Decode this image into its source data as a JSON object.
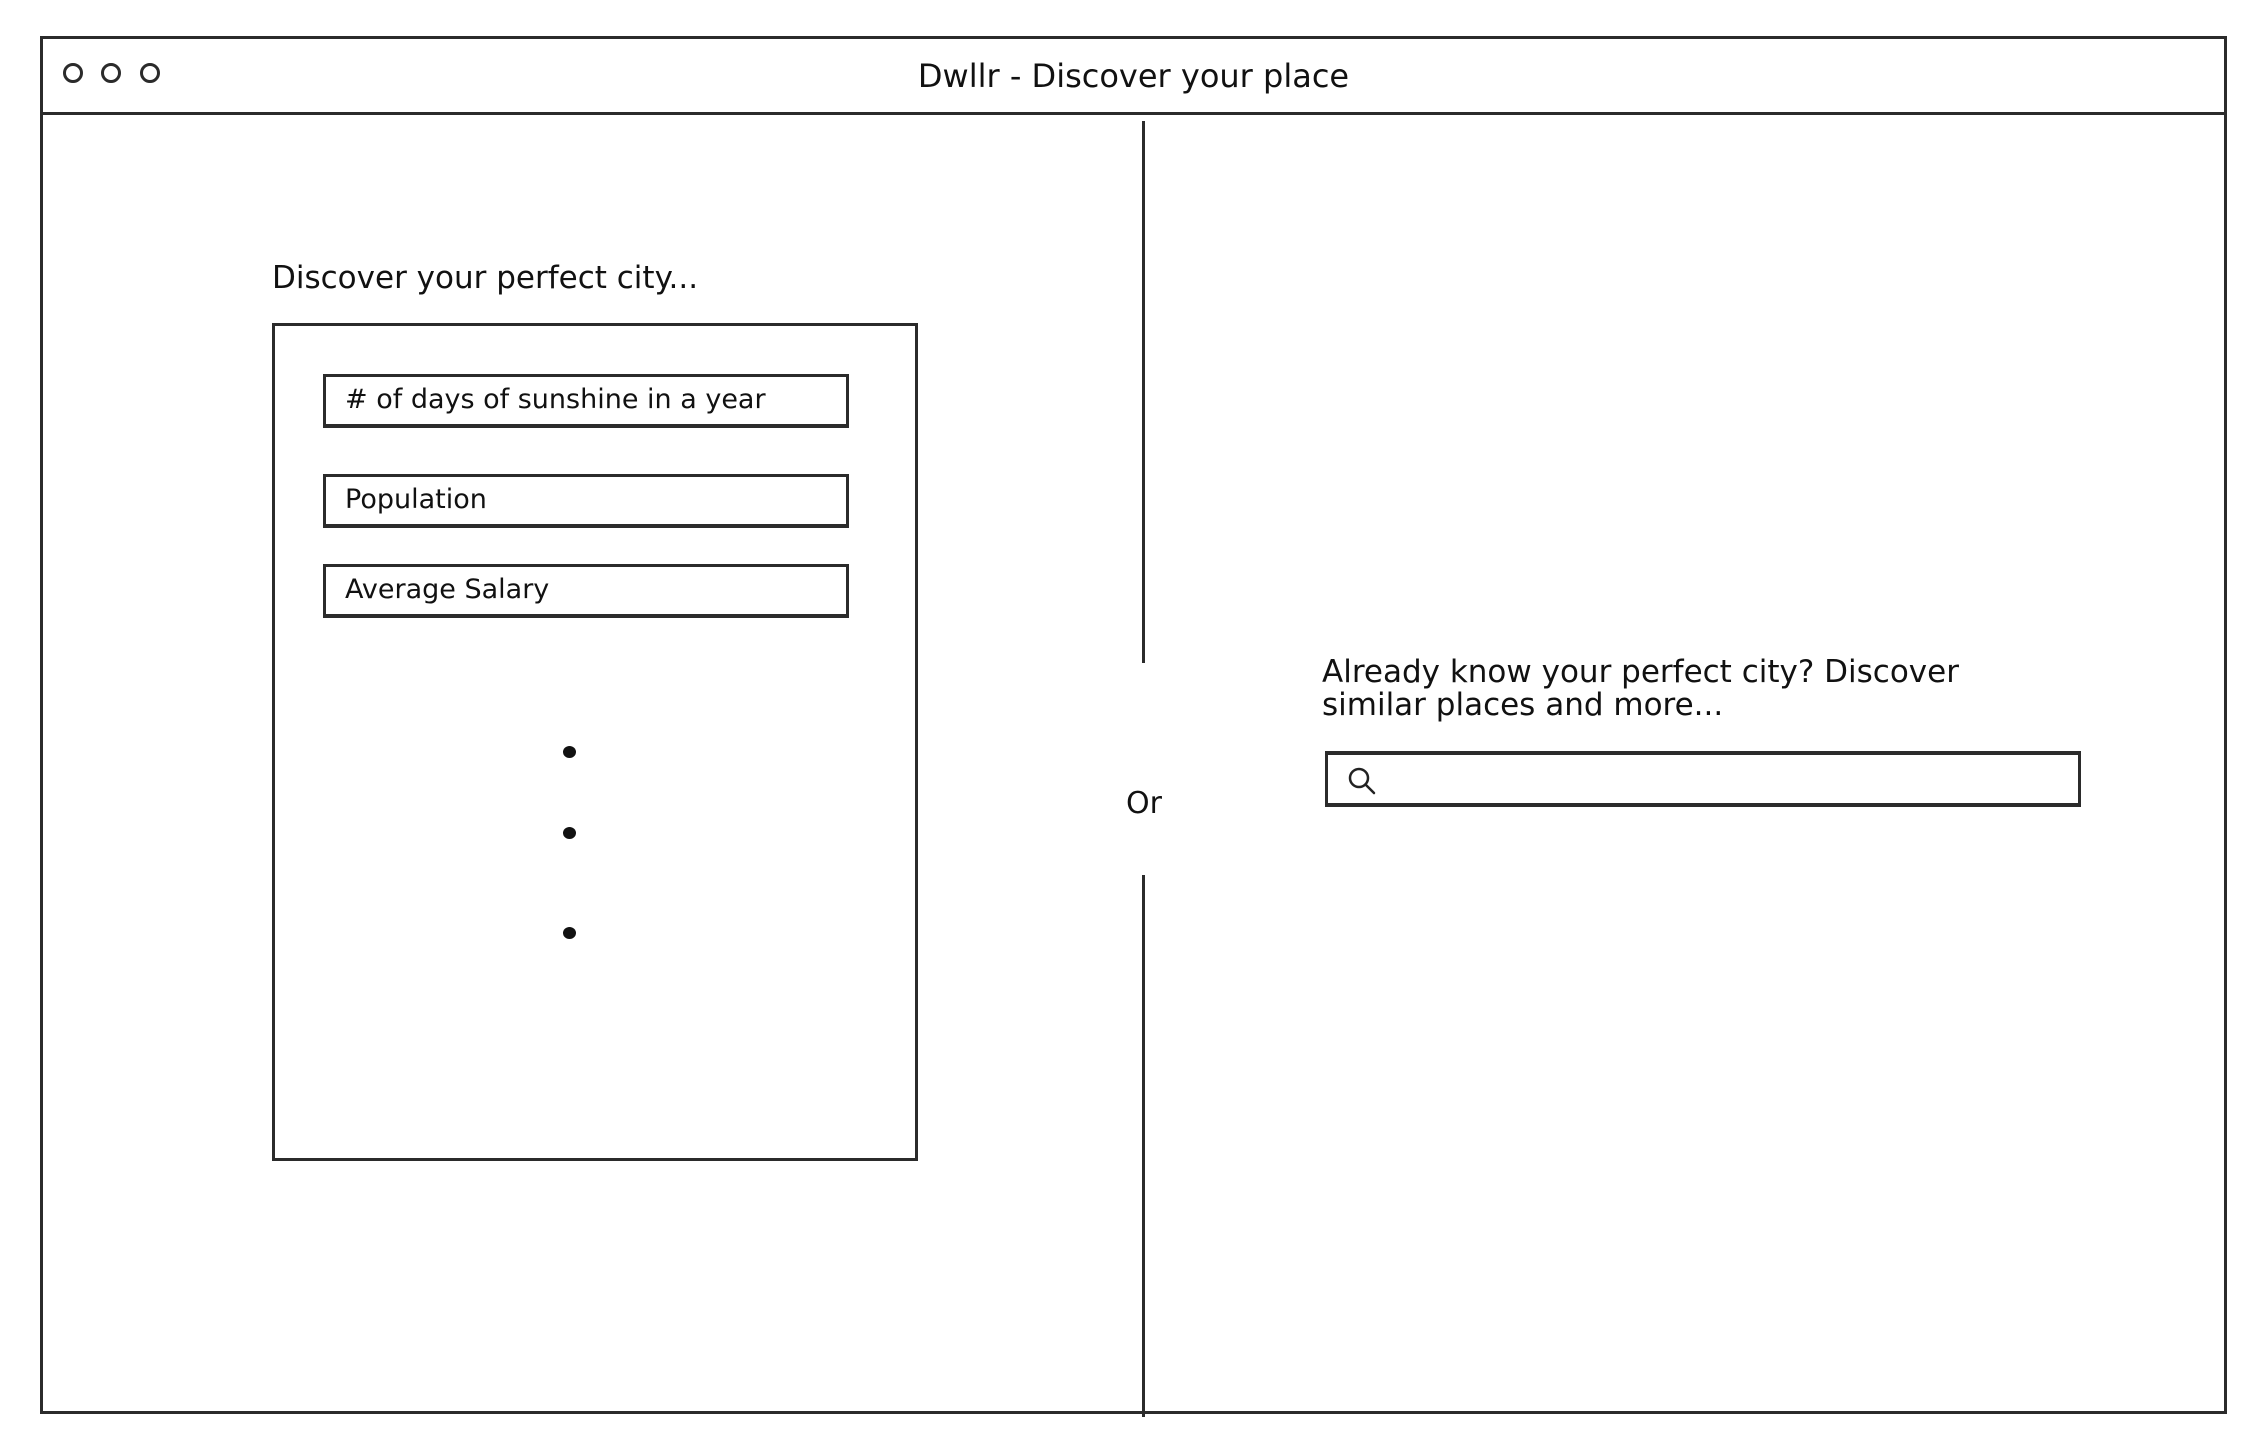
{
  "window": {
    "title": "Dwllr - Discover your place"
  },
  "discover": {
    "heading": "Discover your perfect city...",
    "fields": [
      {
        "label": "# of days of sunshine in a year"
      },
      {
        "label": "Population"
      },
      {
        "label": "Average Salary"
      }
    ]
  },
  "separator": {
    "label": "Or"
  },
  "search": {
    "heading": "Already know your perfect city?  Discover similar places and more...",
    "placeholder": "",
    "value": ""
  }
}
